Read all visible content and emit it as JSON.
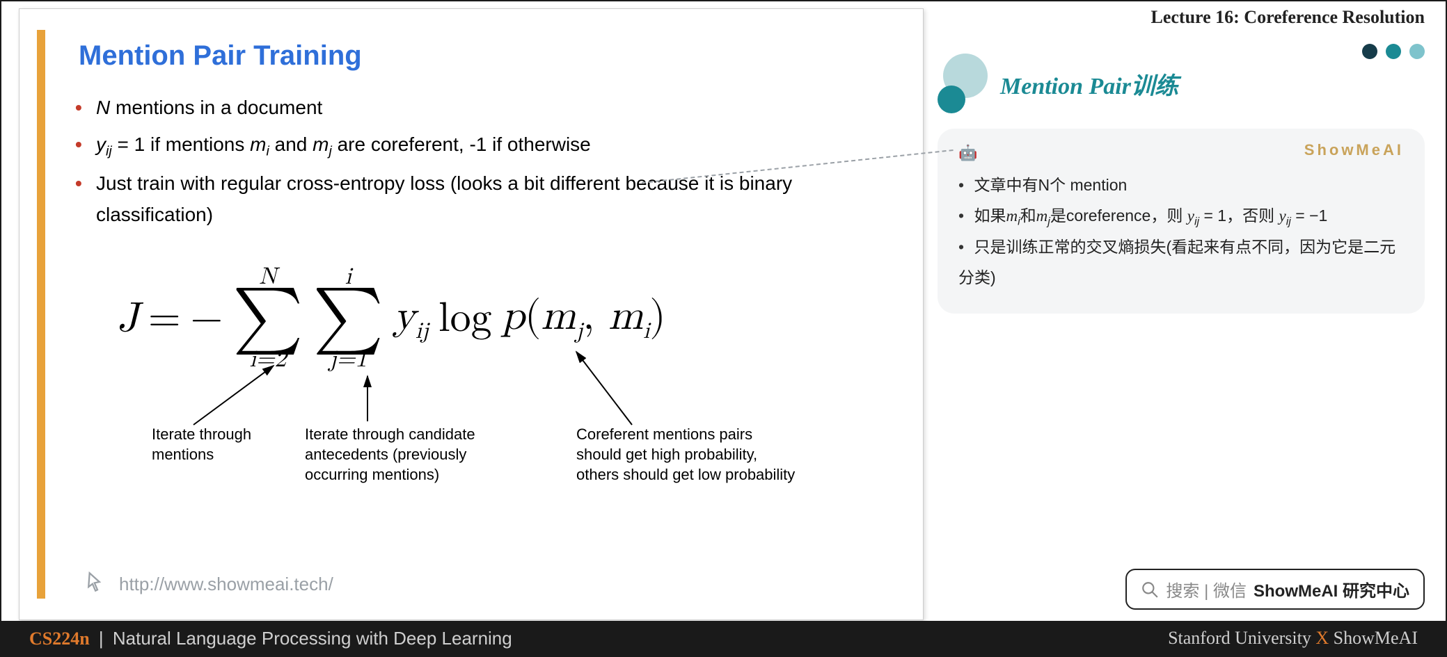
{
  "lecture_header": "Lecture 16: Coreference Resolution",
  "slide": {
    "title": "Mention Pair Training",
    "bullet1_pre": "N",
    "bullet1_post": " mentions in a document",
    "bullet2_a": "y",
    "bullet2_sub": "ij",
    "bullet2_b": " = 1 if mentions ",
    "bullet2_c": "m",
    "bullet2_csub": "i",
    "bullet2_d": " and ",
    "bullet2_e": "m",
    "bullet2_esub": "j",
    "bullet2_f": " are coreferent, -1 if otherwise",
    "bullet3": "Just train with regular cross-entropy loss (looks a bit different because it is binary classification)",
    "formula": {
      "J": "J",
      "eq": "=",
      "minus": "−",
      "sum1_top": "N",
      "sum1_bot": "i=2",
      "sum2_top": "i",
      "sum2_bot": "j=1",
      "y": "y",
      "ysub": "ij",
      "log": "log",
      "p": "p",
      "lp": "(",
      "m1": "m",
      "m1sub": "j",
      "comma": ",",
      "m2": "m",
      "m2sub": "i",
      "rp": ")"
    },
    "label1": "Iterate through mentions",
    "label2": "Iterate through candidate antecedents (previously occurring mentions)",
    "label3": "Coreferent mentions pairs should get high probability, others should get low probability",
    "url": "http://www.showmeai.tech/"
  },
  "right": {
    "section_title": "Mention Pair训练",
    "brand": "ShowMeAI",
    "note1": "文章中有N个 mention",
    "note2_a": "如果",
    "note2_m1": "m",
    "note2_m1s": "i",
    "note2_b": "和",
    "note2_m2": "m",
    "note2_m2s": "j",
    "note2_c": "是coreference，则 ",
    "note2_y1": "y",
    "note2_y1s": "ij",
    "note2_d": " = 1，否则 ",
    "note2_y2": "y",
    "note2_y2s": "ij",
    "note2_e": " = −1",
    "note3": "只是训练正常的交叉熵损失(看起来有点不同，因为它是二元分类)",
    "search_hint": "搜索 | 微信",
    "search_bold": "ShowMeAI 研究中心"
  },
  "footer": {
    "course": "CS224n",
    "pipe": " | ",
    "subtitle": "Natural Language Processing with Deep Learning",
    "right_a": "Stanford University ",
    "right_x": "X",
    "right_b": " ShowMeAI"
  }
}
